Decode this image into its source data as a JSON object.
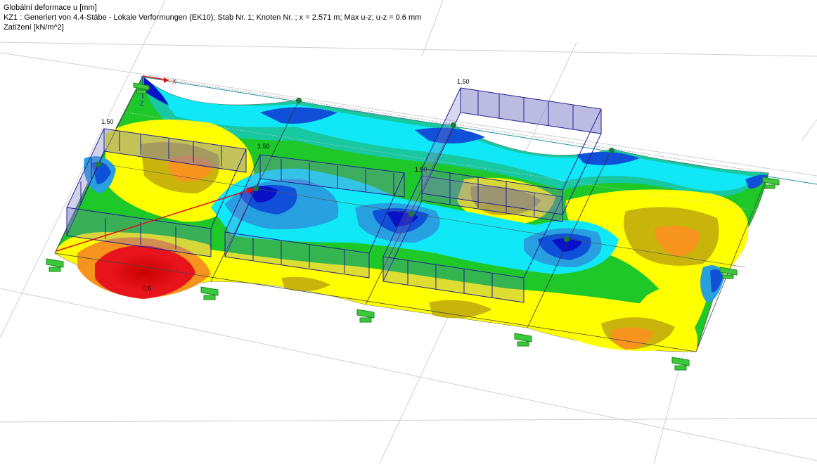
{
  "info": {
    "line1": "Globální deformace u [mm]",
    "line2": "KZ1 : Generiert von  4.4-Stäbe - Lokale Verformungen (EK10); Stab Nr. 1; Knoten Nr. ; x = 2.571 m; Max u-z; u-z = 0.6 mm",
    "line3": "Zatížení [kN/m^2]"
  },
  "load_labels": {
    "left": "1.50",
    "center": "1.50",
    "center_right": "1.50",
    "top_right": "1.50"
  },
  "max_value_label": "0.6",
  "axes": {
    "x": "X",
    "z": "Z"
  },
  "colors": {
    "red": "#e8141c",
    "orange": "#f7941d",
    "olive": "#c8b40a",
    "yellow": "#ffff00",
    "green": "#1ec828",
    "teal": "#18c8a0",
    "cyan": "#10e8f8",
    "lightblue": "#28a0e0",
    "blue": "#1050d8",
    "darkblue": "#0810c8",
    "support": "#3cc83c",
    "load_fill": "#7a7ac8",
    "load_stroke": "#202090",
    "arrow": "#e01010"
  }
}
